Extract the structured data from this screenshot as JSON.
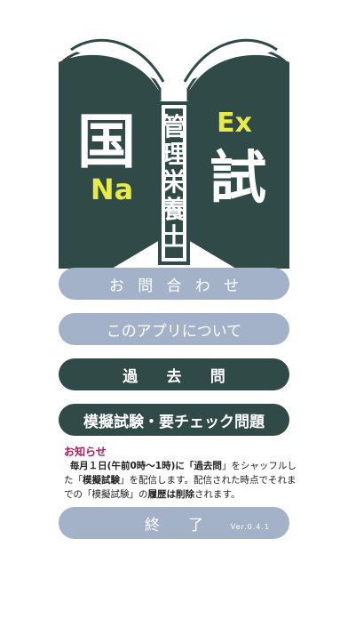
{
  "logo": {
    "left_kanji": "国",
    "left_sub": "Na",
    "right_top": "Ex",
    "right_kanji": "試",
    "spine_chars": [
      "管",
      "理",
      "栄",
      "養",
      "士"
    ],
    "colors": {
      "book": "#2f4a47",
      "pages": "#ffffff",
      "accent": "#e8ea45"
    }
  },
  "menu": {
    "contact": "お問合わせ",
    "about": "このアプリについて",
    "past": "過去問",
    "mock": "模擬試験・要チェック問題"
  },
  "notice": {
    "title": "お知らせ",
    "p1": "毎月１日(",
    "p2": "午前0時〜1時",
    "p3": ")に「",
    "p4": "過去問",
    "p5": "」をシャッフルした「",
    "p6": "模擬試験",
    "p7": "」を配信します。配信された時点でそれまでの「模擬試験」の",
    "p8": "履歴は削除",
    "p9": "されます。"
  },
  "exit": {
    "label": "終了",
    "version": "Ver.0.4.1"
  },
  "colors": {
    "light_button": "#a4b2c9",
    "dark_button": "#2f4a47",
    "notice_title": "#b2195b"
  }
}
